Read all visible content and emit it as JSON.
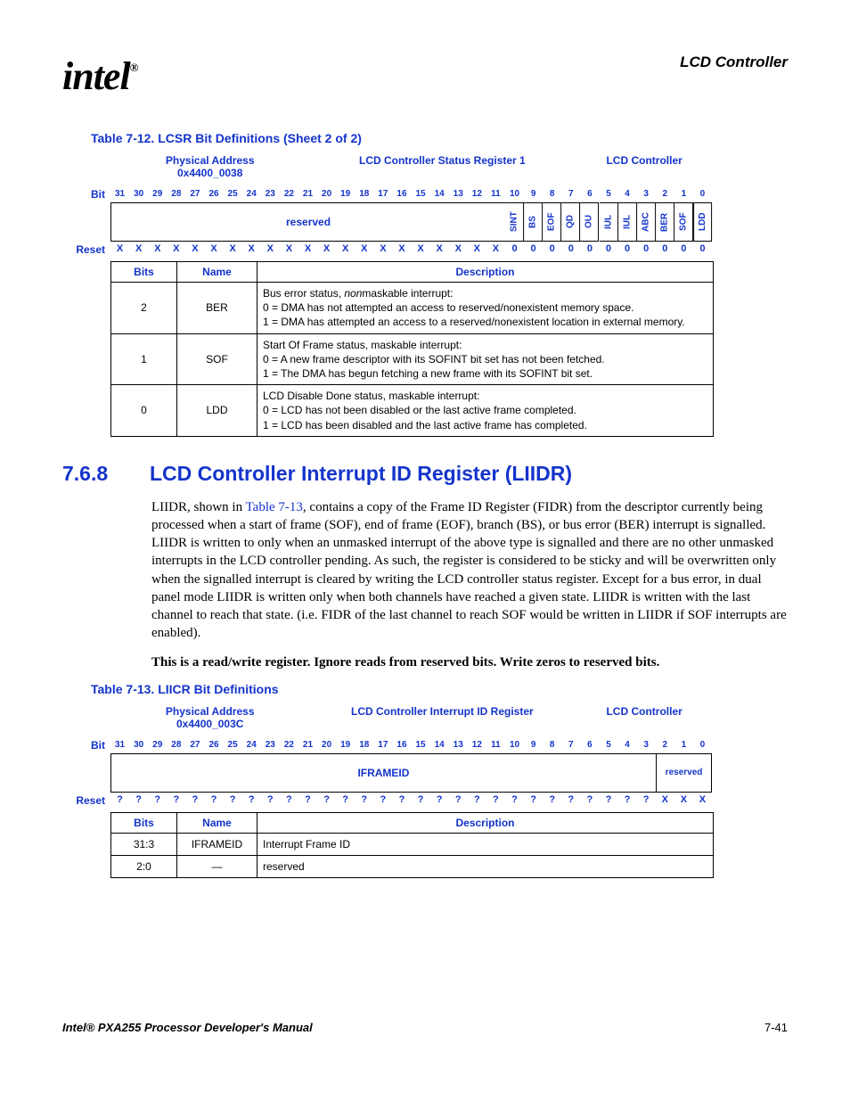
{
  "brand": "intel",
  "header_section": "LCD Controller",
  "table12": {
    "caption": "Table 7-12. LCSR Bit Definitions (Sheet 2 of 2)",
    "phys_addr_label": "Physical Address",
    "phys_addr_value": "0x4400_0038",
    "reg_name": "LCD Controller Status Register 1",
    "right_label": "LCD Controller",
    "bit_label": "Bit",
    "reset_label": "Reset",
    "reserved_label": "reserved",
    "bitfields": [
      "SINT",
      "BS",
      "EOF",
      "QD",
      "OU",
      "IUL",
      "IUL",
      "ABC",
      "BER",
      "SOF",
      "LDD"
    ],
    "reset_low11": [
      "0",
      "0",
      "0",
      "0",
      "0",
      "0",
      "0",
      "0",
      "0",
      "0",
      "0"
    ],
    "hdr_bits": "Bits",
    "hdr_name": "Name",
    "hdr_desc": "Description",
    "rows": [
      {
        "bits": "2",
        "name": "BER",
        "desc": "Bus error status, <i>non</i>maskable interrupt:<br>0 =  DMA has not attempted an access to reserved/nonexistent memory space.<br>1 =  DMA has attempted an access to a reserved/nonexistent location in external memory."
      },
      {
        "bits": "1",
        "name": "SOF",
        "desc": "Start Of Frame status, maskable interrupt:<br>0 =  A new frame descriptor with its SOFINT bit set has not been fetched.<br>1 =  The DMA has begun fetching a new frame with its SOFINT bit set."
      },
      {
        "bits": "0",
        "name": "LDD",
        "desc": "LCD Disable Done status, maskable interrupt:<br>0 =  LCD has not been disabled or the last active frame completed.<br>1 =  LCD has been disabled and the last active frame has completed."
      }
    ]
  },
  "section768": {
    "num": "7.6.8",
    "title": "LCD Controller Interrupt ID Register (LIIDR)"
  },
  "para1_a": "LIIDR, shown in ",
  "para1_link": "Table 7-13",
  "para1_b": ", contains a copy of the Frame ID Register (FIDR) from the descriptor currently being processed when a start of frame (SOF), end of frame (EOF), branch (BS), or bus error (BER) interrupt is signalled. LIIDR is written to only when an unmasked interrupt of the above type is signalled and there are no other unmasked interrupts in the LCD controller pending. As such, the register is considered to be sticky and will be overwritten only when the signalled interrupt is cleared by writing the LCD controller status register. Except for a bus error, in dual panel mode LIIDR is written only when both channels have reached a given state. LIIDR is written with the last channel to reach that state. (i.e. FIDR of the last channel to reach SOF would be written in LIIDR if SOF interrupts are enabled).",
  "para2": "This is a read/write register. Ignore reads from reserved bits. Write zeros to reserved bits.",
  "table13": {
    "caption": "Table 7-13. LIICR Bit Definitions",
    "phys_addr_label": "Physical Address",
    "phys_addr_value": "0x4400_003C",
    "reg_name": "LCD Controller Interrupt ID Register",
    "right_label": "LCD Controller",
    "bit_label": "Bit",
    "reset_label": "Reset",
    "iframeid_label": "IFRAMEID",
    "reserved_label": "reserved",
    "hdr_bits": "Bits",
    "hdr_name": "Name",
    "hdr_desc": "Description",
    "rows": [
      {
        "bits": "31:3",
        "name": "IFRAMEID",
        "desc": "Interrupt Frame ID"
      },
      {
        "bits": "2:0",
        "name": "—",
        "desc": "reserved"
      }
    ]
  },
  "footer_left": "Intel® PXA255 Processor Developer's Manual",
  "footer_right": "7-41"
}
